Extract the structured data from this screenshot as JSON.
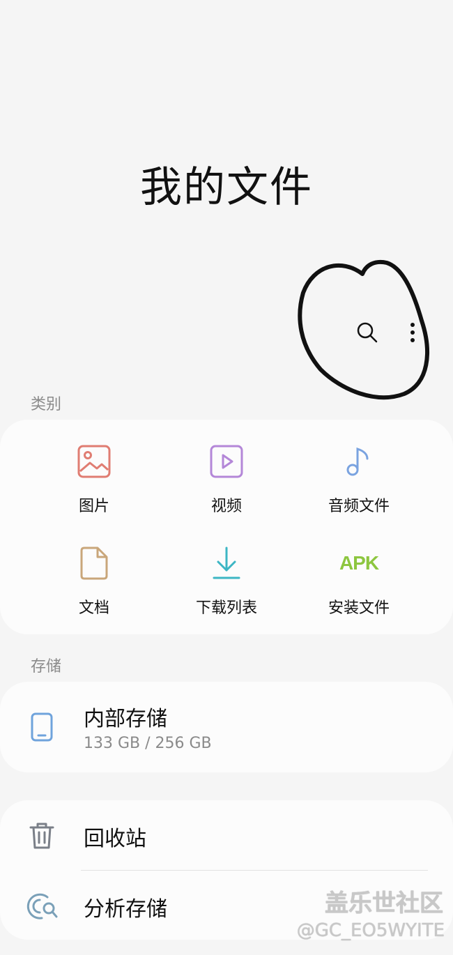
{
  "header": {
    "title": "我的文件"
  },
  "toolbar": {
    "search_icon": "search-icon",
    "more_icon": "more-vertical-icon"
  },
  "categories": {
    "label": "类别",
    "items": [
      {
        "label": "图片",
        "icon": "image-icon",
        "color": "#e07d72"
      },
      {
        "label": "视频",
        "icon": "video-icon",
        "color": "#b487d8"
      },
      {
        "label": "音频文件",
        "icon": "music-note-icon",
        "color": "#7aa3e0"
      },
      {
        "label": "文档",
        "icon": "document-icon",
        "color": "#c9a67a"
      },
      {
        "label": "下载列表",
        "icon": "download-icon",
        "color": "#3cb6c4"
      },
      {
        "label": "安装文件",
        "icon": "apk-icon",
        "icon_text": "APK",
        "color": "#8dc63f"
      }
    ]
  },
  "storage": {
    "label": "存储",
    "internal": {
      "name": "内部存储",
      "size": "133 GB / 256 GB",
      "icon": "phone-icon",
      "color": "#6fa3dc"
    }
  },
  "utilities": {
    "recycle_bin": {
      "label": "回收站",
      "icon": "trash-icon"
    },
    "analyze_storage": {
      "label": "分析存储",
      "icon": "analyze-storage-icon"
    }
  },
  "watermark": {
    "site": "盖乐世社区",
    "user": "@GC_EO5WYITE"
  }
}
